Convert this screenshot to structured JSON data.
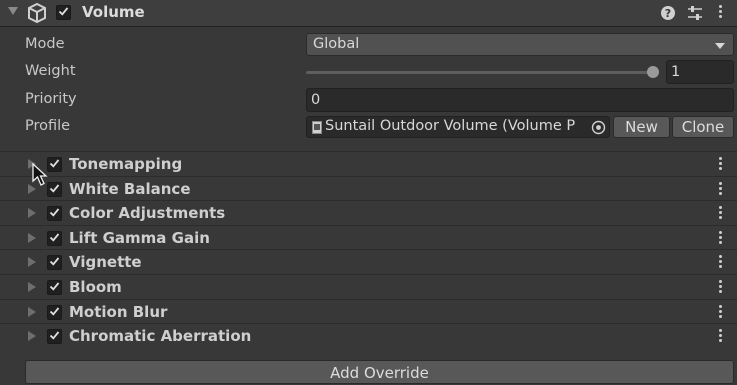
{
  "header": {
    "title": "Volume",
    "enabled": true,
    "icons": [
      "cube-icon",
      "help-icon",
      "preset-sliders-icon",
      "kebab-menu-icon"
    ]
  },
  "properties": {
    "mode": {
      "label": "Mode",
      "value": "Global"
    },
    "weight": {
      "label": "Weight",
      "value": "1",
      "slider_fraction": 1.0
    },
    "priority": {
      "label": "Priority",
      "value": "0"
    },
    "profile": {
      "label": "Profile",
      "value": "Suntail Outdoor Volume (Volume P",
      "new_label": "New",
      "clone_label": "Clone"
    }
  },
  "overrides": [
    {
      "label": "Tonemapping",
      "enabled": true
    },
    {
      "label": "White Balance",
      "enabled": true
    },
    {
      "label": "Color Adjustments",
      "enabled": true
    },
    {
      "label": "Lift Gamma Gain",
      "enabled": true
    },
    {
      "label": "Vignette",
      "enabled": true
    },
    {
      "label": "Bloom",
      "enabled": true
    },
    {
      "label": "Motion Blur",
      "enabled": true
    },
    {
      "label": "Chromatic Aberration",
      "enabled": true
    }
  ],
  "add_override_label": "Add Override"
}
